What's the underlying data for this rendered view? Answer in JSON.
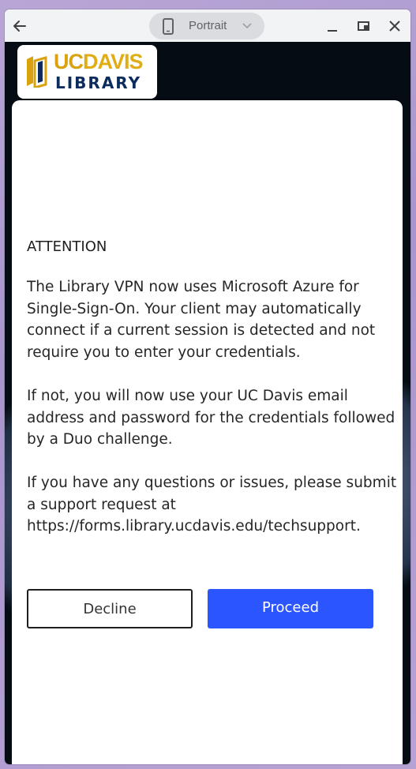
{
  "window": {
    "orientation_label": "Portrait"
  },
  "logo": {
    "uc": "UC",
    "davis": "DAVIS",
    "library": "LIBRARY"
  },
  "dialog": {
    "heading": "ATTENTION",
    "paragraph1": "The Library VPN now uses Microsoft Azure for Single-Sign-On. Your client may automatically connect if a current session is detected and not require you to enter your credentials.",
    "paragraph2": "If not, you will now use your UC Davis email address and password for the credentials followed by a Duo challenge.",
    "paragraph3": "If you have any questions or issues, please submit a support request at https://forms.library.ucdavis.edu/techsupport.",
    "decline_label": "Decline",
    "proceed_label": "Proceed"
  },
  "colors": {
    "proceed_button": "#2a55ff",
    "logo_gold": "#d8a30f",
    "logo_navy": "#0b2c5c",
    "background": "#050c14"
  }
}
